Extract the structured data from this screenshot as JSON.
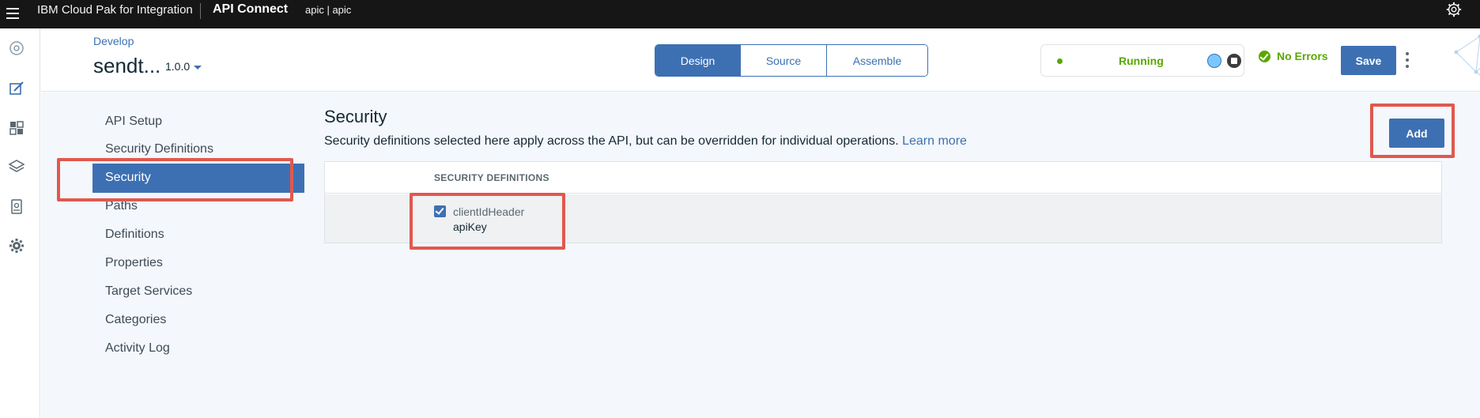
{
  "topbar": {
    "brand": "IBM Cloud Pak for Integration",
    "product": "API Connect",
    "instance": "apic | apic"
  },
  "header": {
    "breadcrumb": "Develop",
    "api_title": "sendt...",
    "version": "1.0.0",
    "tabs": [
      {
        "label": "Design",
        "active": true
      },
      {
        "label": "Source",
        "active": false
      },
      {
        "label": "Assemble",
        "active": false
      }
    ],
    "status": "Running",
    "errors": "No Errors",
    "save_label": "Save"
  },
  "sidenav": {
    "items": [
      {
        "label": "API Setup"
      },
      {
        "label": "Security Definitions"
      },
      {
        "label": "Security",
        "active": true
      },
      {
        "label": "Paths"
      },
      {
        "label": "Definitions"
      },
      {
        "label": "Properties"
      },
      {
        "label": "Target Services"
      },
      {
        "label": "Categories"
      },
      {
        "label": "Activity Log"
      }
    ]
  },
  "content": {
    "title": "Security",
    "description": "Security definitions selected here apply across the API, but can be overridden for individual operations.",
    "learn_more": "Learn more",
    "add_label": "Add",
    "table": {
      "header": "SECURITY DEFINITIONS",
      "rows": [
        {
          "name": "clientIdHeader",
          "type": "apiKey",
          "checked": true
        }
      ]
    }
  },
  "colors": {
    "accent": "#3d70b2",
    "success": "#5aa700",
    "highlight": "#e0584f",
    "topbar": "#161616"
  }
}
